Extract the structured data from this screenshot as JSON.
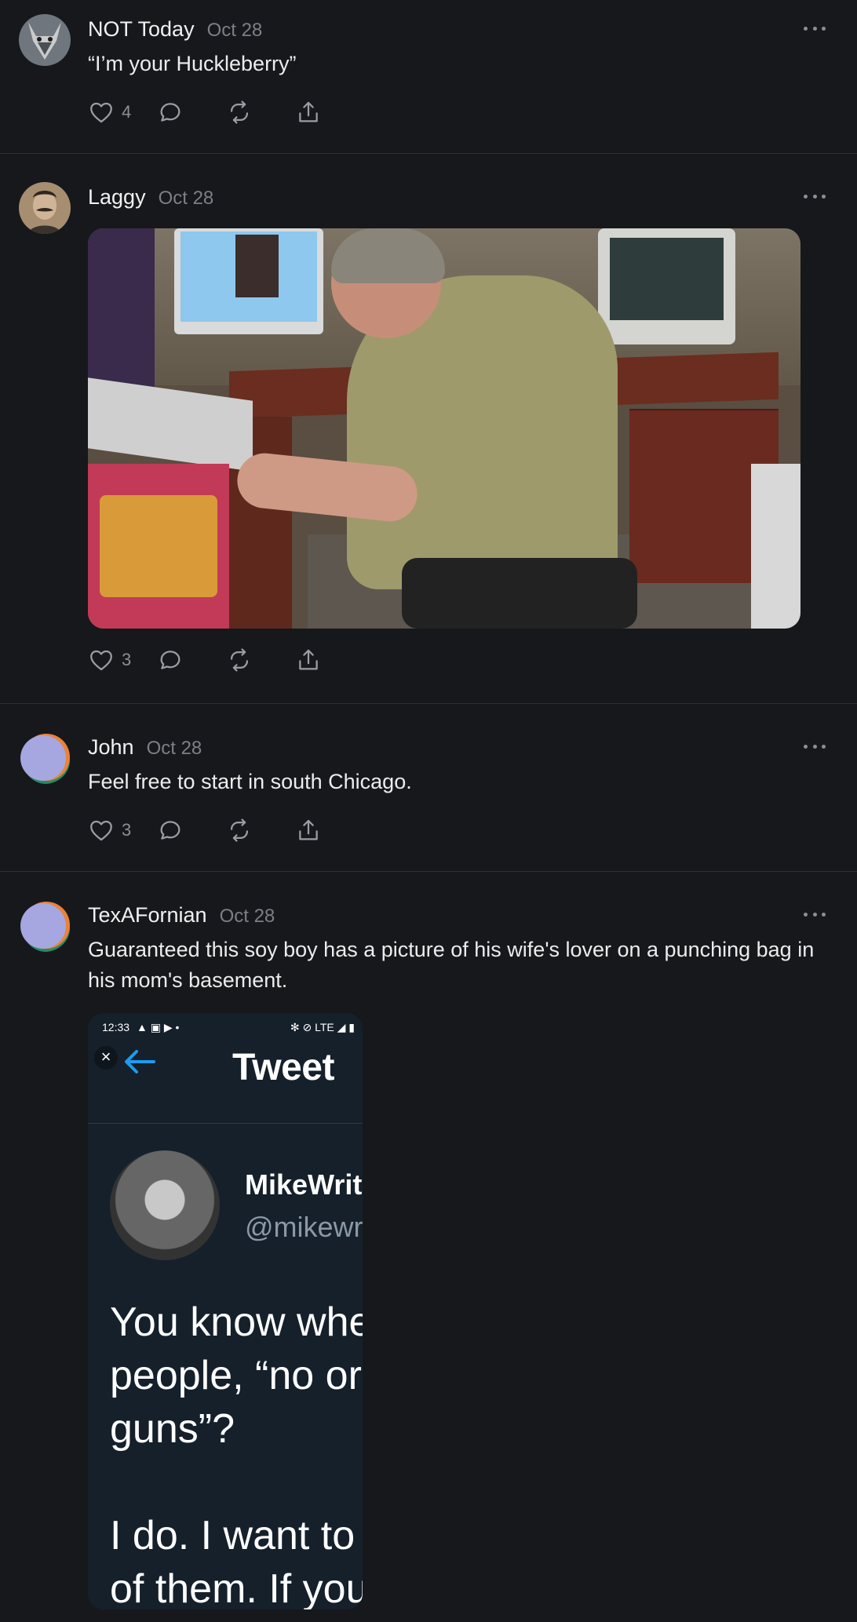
{
  "feed": {
    "posts": [
      {
        "author": "NOT Today",
        "date": "Oct 28",
        "avatar": "wolf-avatar",
        "text": "“I’m your Huckleberry”",
        "likes": "4"
      },
      {
        "author": "Laggy",
        "date": "Oct 28",
        "avatar": "mustache-portrait-avatar",
        "likes": "3"
      },
      {
        "author": "John",
        "date": "Oct 28",
        "avatar": "default-circle-avatar",
        "text": "Feel free to start in south Chicago.",
        "likes": "3"
      },
      {
        "author": "TexAFornian",
        "date": "Oct 28",
        "avatar": "default-circle-avatar",
        "text": "Guaranteed this soy boy has a picture of his wife's lover on a punching bag in his mom's basement.",
        "tweet": {
          "status_time": "12:33",
          "status_right": "LTE",
          "title": "Tweet",
          "name": "MikeWrit",
          "handle": "@mikewr",
          "body": "You know whe\npeople, “no or\nguns”?\n\nI do. I want to\nof them. If you"
        }
      }
    ]
  },
  "icons": {
    "like": "heart-icon",
    "reply": "comment-icon",
    "repost": "repost-icon",
    "share": "share-icon",
    "more": "more-icon"
  },
  "colors": {
    "background": "#16181c",
    "divider": "#2c2f35",
    "secondary_text": "#7c7f86"
  }
}
